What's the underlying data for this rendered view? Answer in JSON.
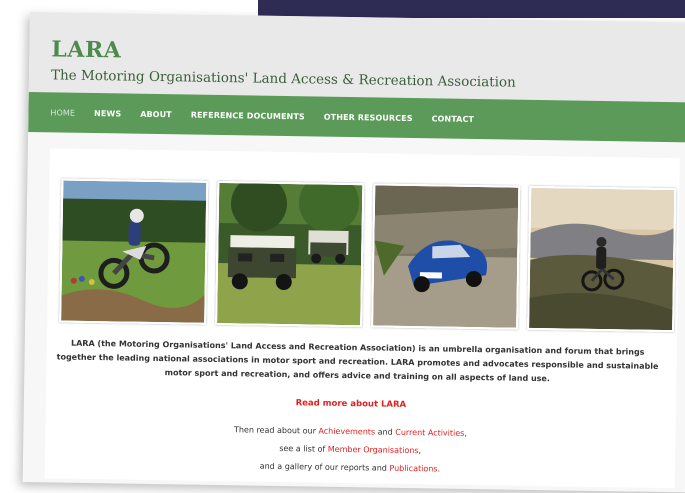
{
  "site": {
    "logo": "LARA",
    "tagline": "The Motoring Organisations' Land Access & Recreation Association"
  },
  "nav": {
    "items": [
      {
        "label": "HOME",
        "active": true
      },
      {
        "label": "NEWS"
      },
      {
        "label": "ABOUT"
      },
      {
        "label": "REFERENCE DOCUMENTS"
      },
      {
        "label": "OTHER RESOURCES"
      },
      {
        "label": "CONTACT"
      }
    ]
  },
  "photos": {
    "items": [
      {
        "subject": "motocross-jump"
      },
      {
        "subject": "land-rovers"
      },
      {
        "subject": "rally-car"
      },
      {
        "subject": "trail-bike-hillside"
      }
    ]
  },
  "intro": {
    "text": "LARA (the Motoring Organisations' Land Access and Recreation Association) is an umbrella organisation and forum that brings together the leading national associations in motor sport and recreation. LARA promotes and advocates responsible and sustainable motor sport and recreation, and offers advice and training on all aspects of land use."
  },
  "read_more": {
    "label": "Read more about LARA"
  },
  "links": {
    "line1_prefix": "Then read about our ",
    "achievements": "Achievements",
    "line1_mid": " and ",
    "current_activities": "Current Activities",
    "line1_suffix": ",",
    "line2_prefix": "see a list of ",
    "member_organisations": "Member Organisations",
    "line2_suffix": ",",
    "line3_prefix": "and a gallery of our reports and ",
    "publications": "Publications",
    "line3_suffix": "."
  },
  "colors": {
    "brand_green": "#5b9a59",
    "link_red": "#e0211f",
    "banner_navy": "#2e2b55"
  }
}
